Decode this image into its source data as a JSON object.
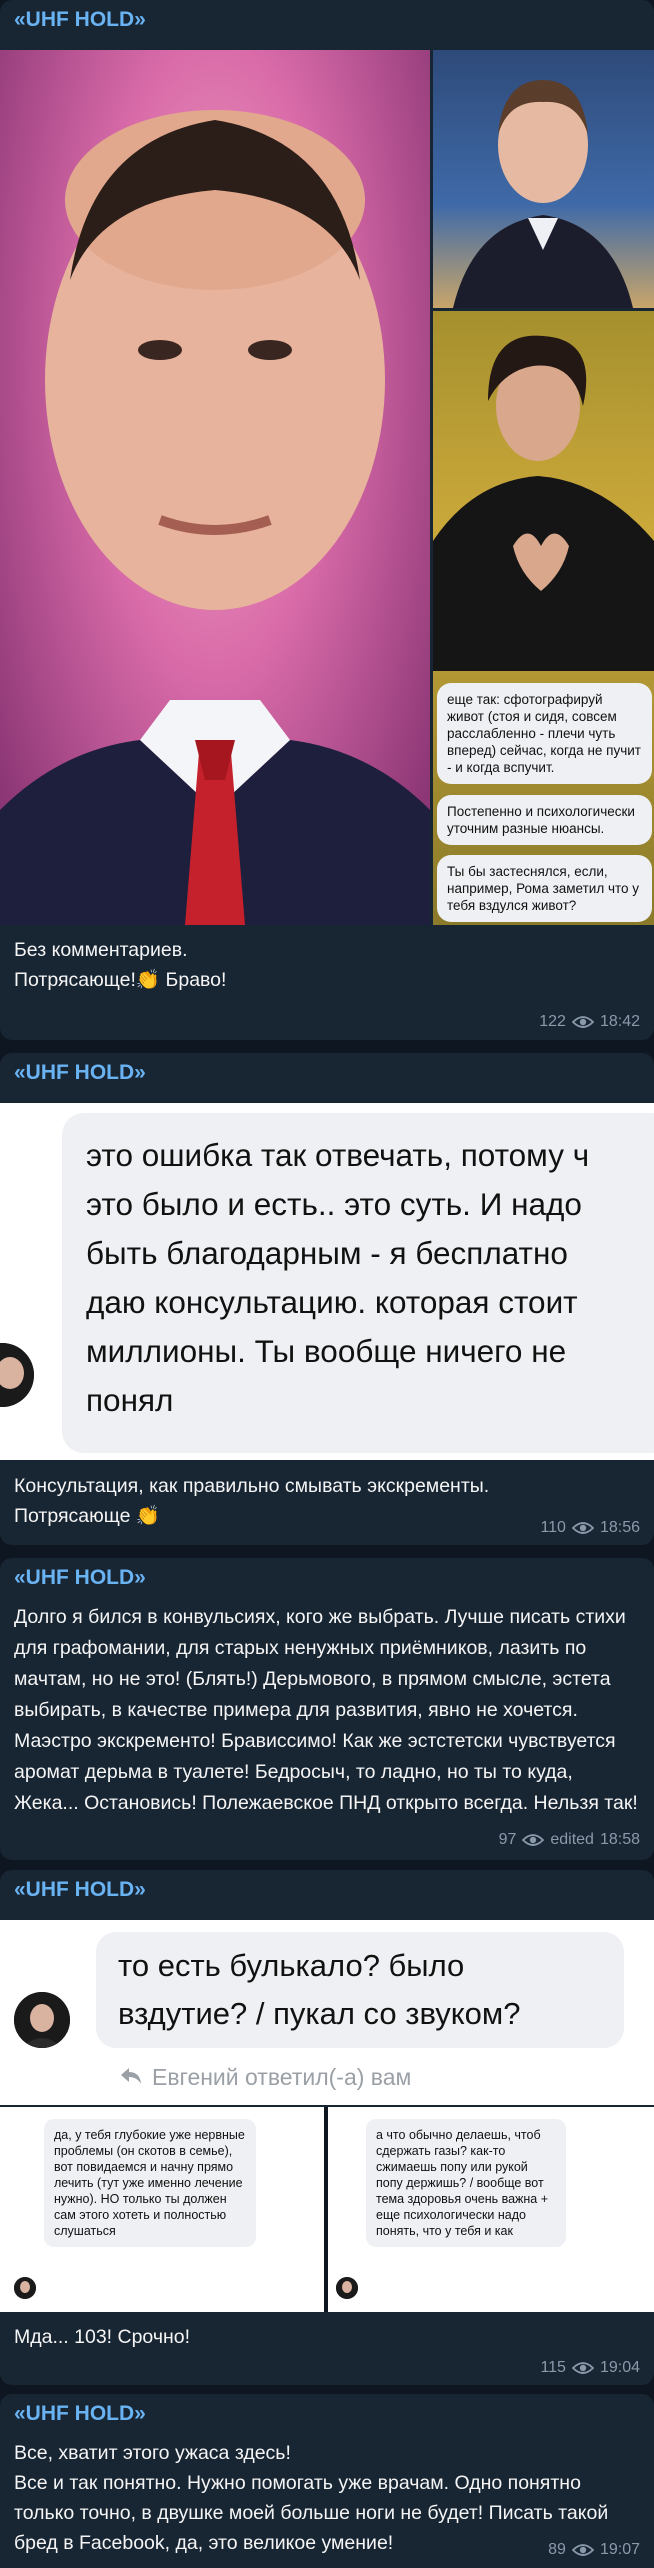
{
  "channel_name": "«UHF HOLD»",
  "posts": [
    {
      "caption": "Без комментариев.\nПотрясающе!👏 Браво!",
      "views": "122",
      "time": "18:42",
      "chat_bubbles": [
        "еще так: сфотографируй живот (стоя и сидя, совсем расслабленно - плечи чуть вперед) сейчас, когда не пучит - и когда вспучит.",
        "Постепенно и психологически уточним разные нюансы.",
        "Ты бы застеснялся, если, например, Рома заметил что у тебя вздулся живот?"
      ]
    },
    {
      "screenshot_text": "это ошибка так отвечать, потому ч\nэто было и есть.. это суть. И надо\nбыть благодарным - я бесплатно\nдаю консультацию. которая стоит\nмиллионы. Ты вообще ничего не\nпонял",
      "caption": "Консультация, как правильно смывать экскременты.\nПотрясающе 👏",
      "views": "110",
      "time": "18:56"
    },
    {
      "caption": "Долго я бился в конвульсиях, кого же выбрать. Лучше писать стихи для графомании, для старых ненужных приёмников, лазить по мачтам, но не это! (Блять!) Дерьмового, в прямом смысле, эстета выбирать, в качестве примера для развития, явно не хочется. Маэстро экскременто! Брависсимо! Как же эстстетски чувствуется аромат дерьма в туалете! Бедросыч, то ладно, но ты то куда, Жека... Остановись! Полежаевское ПНД открыто всегда. Нельзя так!",
      "views": "97",
      "edited": "edited",
      "time": "18:58"
    },
    {
      "screenshot_text": "то есть булькало? было\nвздутие? / пукал со звуком?",
      "reply_note": "Евгений ответил(-а) вам",
      "left_bubble": "да, у тебя глубокие уже нервные проблемы (он скотов в семье), вот повидаемся и начну прямо лечить (тут уже именно лечение нужно). НО только ты должен сам этого хотеть и полностью слушаться",
      "right_bubble": "а что обычно делаешь, чтоб сдержать газы? как-то сжимаешь попу или рукой попу держишь? / вообще вот тема здоровья очень важна + еще психологически надо понять, что у тебя и как",
      "caption": "Мда... 103! Срочно!",
      "views": "115",
      "time": "19:04"
    },
    {
      "caption": "Все, хватит этого ужаса здесь!\nВсе и так понятно. Нужно помогать уже врачам. Одно понятно только точно, в двушке моей больше ноги не будет! Писать такой бред в Facebook, да, это великое умение!",
      "views": "89",
      "time": "19:07"
    }
  ]
}
